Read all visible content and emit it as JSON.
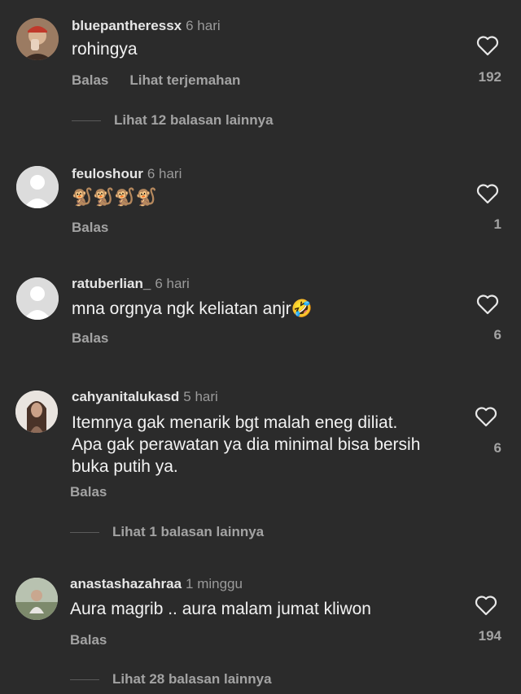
{
  "comments": [
    {
      "username": "bluepantheressx",
      "time": "6 hari",
      "text": "rohingya",
      "reply_label": "Balas",
      "translate_label": "Lihat terjemahan",
      "likes": "192",
      "more_replies": "Lihat 12 balasan lainnya",
      "avatar": "photo-avatar"
    },
    {
      "username": "feuloshour",
      "time": "6 hari",
      "text": "🐒🐒🐒🐒",
      "reply_label": "Balas",
      "likes": "1",
      "avatar": "default-avatar"
    },
    {
      "username": "ratuberlian_",
      "time": "6 hari",
      "text": "mna orgnya ngk keliatan anjr🤣",
      "reply_label": "Balas",
      "likes": "6",
      "avatar": "default-avatar"
    },
    {
      "username": "cahyanitalukasd",
      "time": "5 hari",
      "text_lines": [
        "Itemnya gak menarik bgt malah eneg diliat.",
        "Apa gak perawatan ya dia minimal bisa bersih",
        "buka putih ya."
      ],
      "reply_label": "Balas",
      "likes": "6",
      "more_replies": "Lihat 1 balasan lainnya",
      "avatar": "photo-avatar"
    },
    {
      "username": "anastashazahraa",
      "time": "1 minggu",
      "text": "Aura magrib .. aura malam jumat kliwon",
      "reply_label": "Balas",
      "likes": "194",
      "more_replies": "Lihat 28 balasan lainnya",
      "avatar": "photo-avatar"
    }
  ],
  "colors": {
    "background": "#2b2b2b",
    "text": "#f2f2f2",
    "muted": "#a3a3a3"
  }
}
